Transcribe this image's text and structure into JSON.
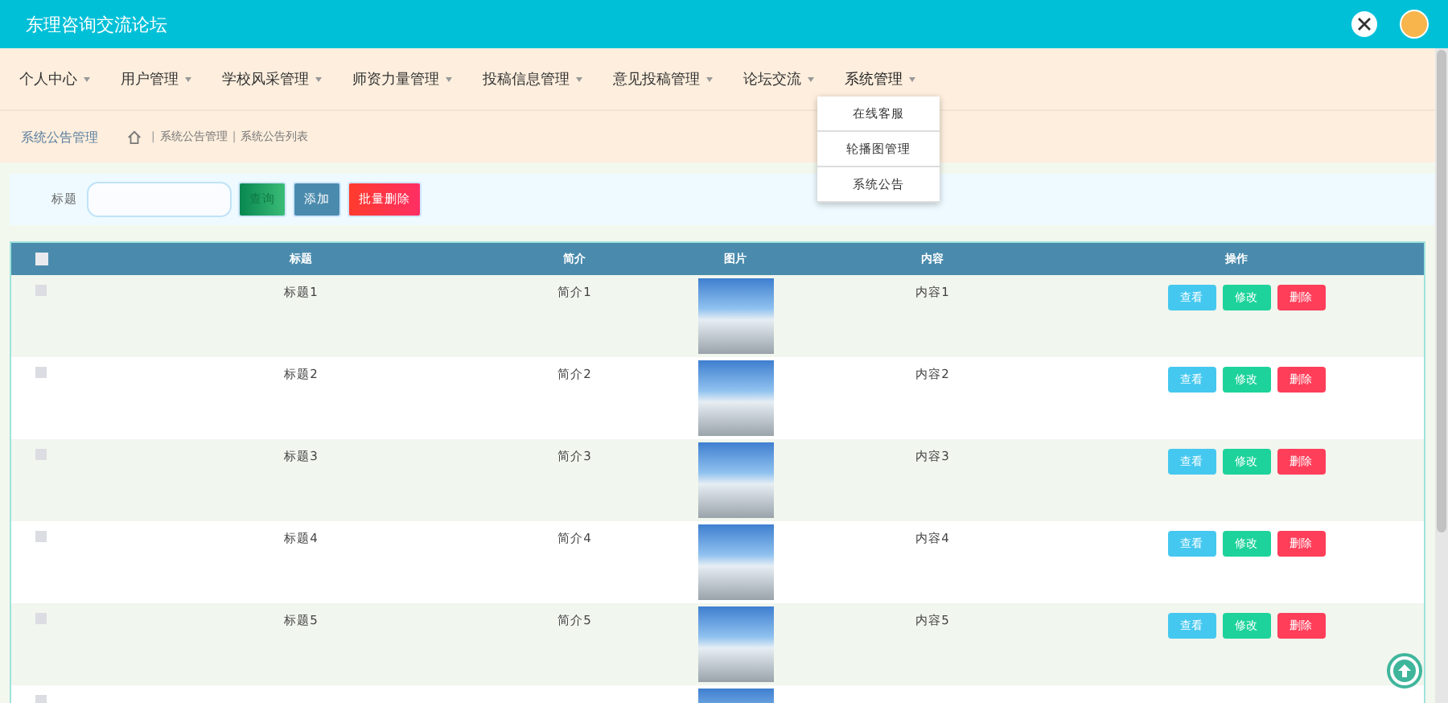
{
  "header": {
    "title": "东理咨询交流论坛"
  },
  "nav": [
    {
      "label": "个人中心",
      "expanded": false
    },
    {
      "label": "用户管理",
      "expanded": false
    },
    {
      "label": "学校风采管理",
      "expanded": false
    },
    {
      "label": "师资力量管理",
      "expanded": false
    },
    {
      "label": "投稿信息管理",
      "expanded": false
    },
    {
      "label": "意见投稿管理",
      "expanded": false
    },
    {
      "label": "论坛交流",
      "expanded": false
    },
    {
      "label": "系统管理",
      "expanded": true,
      "menu": [
        "在线客服",
        "轮播图管理",
        "系统公告"
      ]
    }
  ],
  "breadcrumb": {
    "section": "系统公告管理",
    "path": [
      {
        "separator": "|",
        "label": "系统公告管理"
      },
      {
        "separator": "|",
        "label": "系统公告列表"
      }
    ]
  },
  "search": {
    "label": "标题",
    "search_button": "查询",
    "add_button": "添加",
    "batch_delete_button": "批量删除"
  },
  "table": {
    "all_checked": false,
    "columns": [
      "标题",
      "简介",
      "图片",
      "内容",
      "操作"
    ],
    "rows": [
      {
        "checked": false,
        "title": "标题1",
        "intro": "简介1",
        "content": "内容1",
        "actions": [
          "查看",
          "修改",
          "删除"
        ]
      },
      {
        "checked": false,
        "title": "标题2",
        "intro": "简介2",
        "content": "内容2",
        "actions": [
          "查看",
          "修改",
          "删除"
        ]
      },
      {
        "checked": false,
        "title": "标题3",
        "intro": "简介3",
        "content": "内容3",
        "actions": [
          "查看",
          "修改",
          "删除"
        ]
      },
      {
        "checked": false,
        "title": "标题4",
        "intro": "简介4",
        "content": "内容4",
        "actions": [
          "查看",
          "修改",
          "删除"
        ]
      },
      {
        "checked": false,
        "title": "标题5",
        "intro": "简介5",
        "content": "内容5",
        "actions": [
          "查看",
          "修改",
          "删除"
        ]
      },
      {
        "checked": false
      }
    ]
  }
}
